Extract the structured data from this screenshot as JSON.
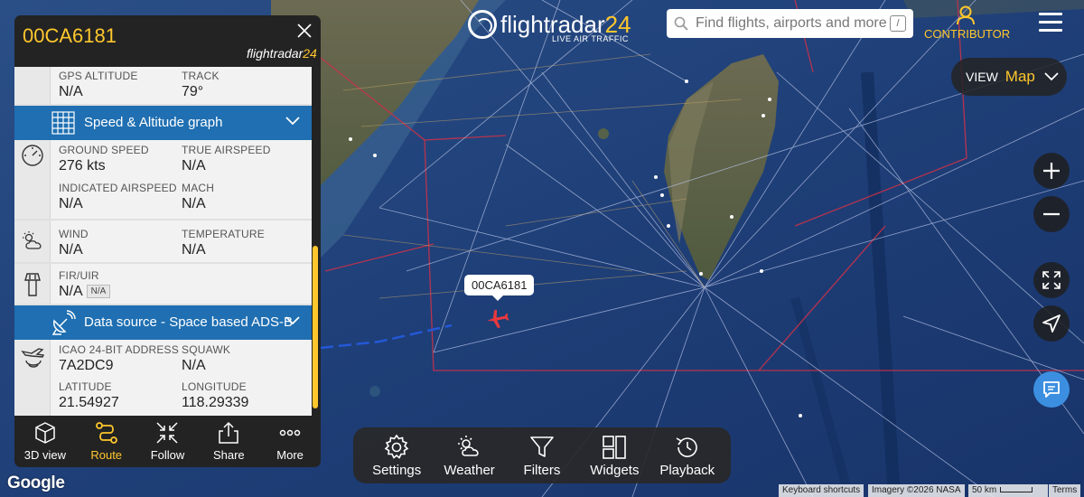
{
  "header": {
    "logo_main": "flightradar",
    "logo_num": "24",
    "logo_sub": "LIVE AIR TRAFFIC",
    "search_placeholder": "Find flights, airports and more",
    "search_shortcut": "/",
    "contributor_label": "CONTRIBUTOR"
  },
  "view": {
    "label": "VIEW",
    "value": "Map"
  },
  "panel": {
    "callsign": "00CA6181",
    "brand_main": "flightradar",
    "brand_num": "24",
    "gps_altitude": {
      "label": "GPS ALTITUDE",
      "value": "N/A"
    },
    "track": {
      "label": "TRACK",
      "value": "79°"
    },
    "speed_bar": "Speed & Altitude graph",
    "ground_speed": {
      "label": "GROUND SPEED",
      "value": "276 kts"
    },
    "true_airspeed": {
      "label": "TRUE AIRSPEED",
      "value": "N/A"
    },
    "indicated_airspeed": {
      "label": "INDICATED AIRSPEED",
      "value": "N/A"
    },
    "mach": {
      "label": "MACH",
      "value": "N/A"
    },
    "wind": {
      "label": "WIND",
      "value": "N/A"
    },
    "temperature": {
      "label": "TEMPERATURE",
      "value": "N/A"
    },
    "fir": {
      "label": "FIR/UIR",
      "value": "N/A",
      "badge": "N/A"
    },
    "source_bar": "Data source - Space based ADS-B",
    "icao": {
      "label": "ICAO 24-BIT ADDRESS",
      "value": "7A2DC9"
    },
    "squawk": {
      "label": "SQUAWK",
      "value": "N/A"
    },
    "latitude": {
      "label": "LATITUDE",
      "value": "21.54927"
    },
    "longitude": {
      "label": "LONGITUDE",
      "value": "118.29339"
    },
    "scroll_position": 0.75
  },
  "panel_nav": [
    {
      "label": "3D view",
      "icon": "cube-icon",
      "active": false
    },
    {
      "label": "Route",
      "icon": "route-icon",
      "active": true
    },
    {
      "label": "Follow",
      "icon": "follow-icon",
      "active": false
    },
    {
      "label": "Share",
      "icon": "share-icon",
      "active": false
    },
    {
      "label": "More",
      "icon": "more-icon",
      "active": false
    }
  ],
  "map": {
    "aircraft_label": "00CA6181"
  },
  "toolbar": [
    {
      "label": "Settings",
      "icon": "gear-icon"
    },
    {
      "label": "Weather",
      "icon": "weather-icon"
    },
    {
      "label": "Filters",
      "icon": "filter-icon"
    },
    {
      "label": "Widgets",
      "icon": "widgets-icon"
    },
    {
      "label": "Playback",
      "icon": "playback-icon"
    }
  ],
  "attribution": {
    "google": "Google",
    "shortcuts": "Keyboard shortcuts",
    "imagery": "Imagery ©2026 NASA",
    "scale": "50 km",
    "terms": "Terms"
  },
  "colors": {
    "accent": "#ffc72c",
    "bar_blue": "#1f6fb2",
    "chat_blue": "#3c8fe0",
    "aircraft": "#e8383d",
    "panel_dark": "#232323"
  }
}
